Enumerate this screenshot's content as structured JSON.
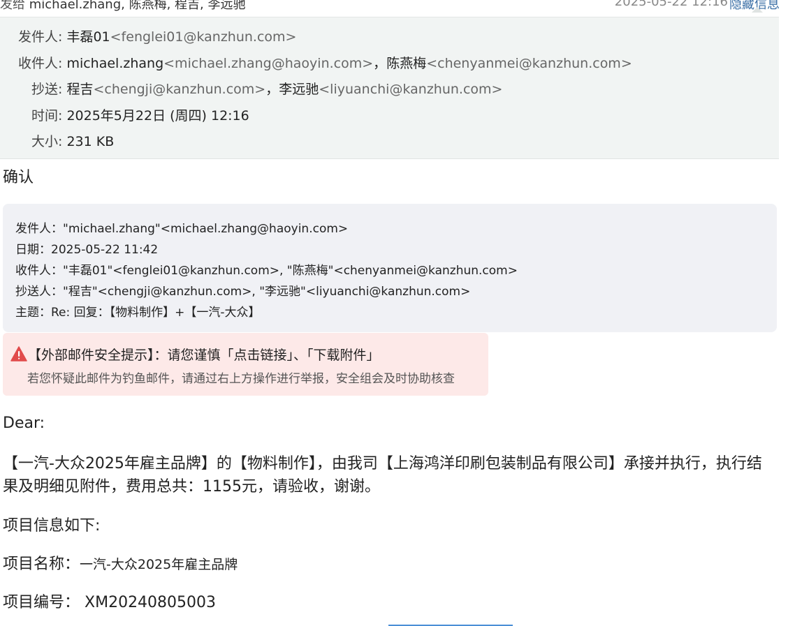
{
  "top_bar": {
    "sent_to_label": "发给",
    "recipients_summary": "michael.zhang, 陈燕梅, 程吉, 李远驰",
    "datetime": "2025-05-22 12:16",
    "toggle_label": "隐藏信息"
  },
  "meta": {
    "from": {
      "label": "发件人:",
      "name": "丰磊01",
      "address": "<fenglei01@kanzhun.com>"
    },
    "to": {
      "label": "收件人:",
      "items": [
        {
          "name": "michael.zhang",
          "address": "<michael.zhang@haoyin.com>",
          "sep": "，"
        },
        {
          "name": "陈燕梅",
          "address": "<chenyanmei@kanzhun.com>",
          "sep": ""
        }
      ]
    },
    "cc": {
      "label": "抄送:",
      "items": [
        {
          "name": "程吉",
          "address": "<chengji@kanzhun.com>",
          "sep": "，"
        },
        {
          "name": "李远驰",
          "address": "<liyuanchi@kanzhun.com>",
          "sep": ""
        }
      ]
    },
    "time": {
      "label": "时间:",
      "value": "2025年5月22日 (周四) 12:16"
    },
    "size": {
      "label": "大小:",
      "value": "231 KB"
    }
  },
  "subject_line": "确认",
  "quoted_header": {
    "from": "发件人：\"michael.zhang\"<michael.zhang@haoyin.com>",
    "date": "日期：2025-05-22 11:42",
    "to": "收件人：\"丰磊01\"<fenglei01@kanzhun.com>, \"陈燕梅\"<chenyanmei@kanzhun.com>",
    "cc": "抄送人：\"程吉\"<chengji@kanzhun.com>, \"李远驰\"<liyuanchi@kanzhun.com>",
    "subject": "主题：Re: 回复：【物料制作】+【一汽-大众】"
  },
  "security_warning": {
    "icon": "warning-triangle-icon",
    "title": "【外部邮件安全提示】：请您谨慎「点击链接」、「下载附件」",
    "subtitle": "若您怀疑此邮件为钓鱼邮件，请通过右上方操作进行举报，安全组会及时协助核查",
    "icon_color": "#e14b4b",
    "background_color": "#fde9e8"
  },
  "body": {
    "greeting": "Dear:",
    "paragraph": "【一汽-大众2025年雇主品牌】的【物料制作】，由我司【上海鸿洋印刷包装制品有限公司】承接并执行，执行结果及明细见附件，费用总共：1155元，请验收，谢谢。",
    "info_heading": "项目信息如下:",
    "project_name_label": "项目名称：",
    "project_name_value": "一汽-大众2025年雇主品牌",
    "project_number_label": "项目编号：",
    "project_number_value": "XM20240805003"
  },
  "colors": {
    "meta_background": "#f1f4f3",
    "quote_background": "#f0f1f5",
    "link_blue": "#3a6ea5"
  }
}
